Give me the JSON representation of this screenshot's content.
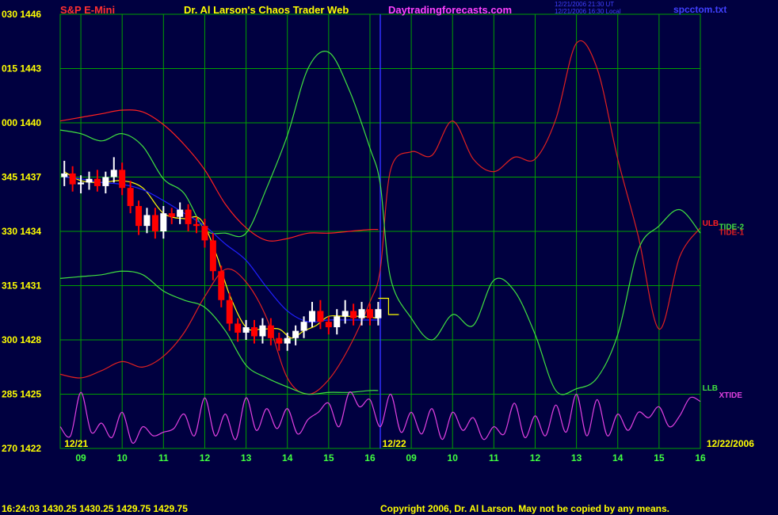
{
  "header": {
    "symbol": "S&P E-Mini",
    "title": "Dr. Al Larson's Chaos Trader Web",
    "site": "Daytradingforecasts.com",
    "stamp_line1": "12/21/2006 21:30 UT",
    "stamp_line2": "12/21/2006 16:30 Local",
    "file": "spcctom.txt"
  },
  "footer": {
    "status": "16:24:03  1430.25  1430.25  1429.75  1429.75",
    "copyright": "Copyright 2006, Dr. Al Larson. May not be copied by any means."
  },
  "colors": {
    "background": "#000040",
    "grid": "#00a000",
    "price_up": "#ffffff",
    "price_down": "#ff0000",
    "ulb": "#ff2020",
    "tide1": "#e02020",
    "tide2": "#40e040",
    "llb": "#40e040",
    "xtide": "#e040e0",
    "moving_avg_fast": "#ffff00",
    "moving_avg_slow": "#2020ff",
    "divider": "#3030ff",
    "title_color": "#ffff00",
    "site_color": "#ff40ff"
  },
  "chart_data": {
    "type": "line",
    "title": "S&P E-Mini",
    "ylabel_pairs": [
      "030 1446",
      "015 1443",
      "000 1440",
      "345 1437",
      "330 1434",
      "315 1431",
      "300 1428",
      "285 1425",
      "270 1422"
    ],
    "ylim": [
      1422,
      1446
    ],
    "y_ticks": [
      1446,
      1443,
      1440,
      1437,
      1434,
      1431,
      1428,
      1425,
      1422
    ],
    "xlim": [
      8.5,
      24.0
    ],
    "x_ticks": [
      {
        "x": 9,
        "label": "09"
      },
      {
        "x": 10,
        "label": "10"
      },
      {
        "x": 11,
        "label": "11"
      },
      {
        "x": 12,
        "label": "12"
      },
      {
        "x": 13,
        "label": "13"
      },
      {
        "x": 14,
        "label": "14"
      },
      {
        "x": 15,
        "label": "15"
      },
      {
        "x": 16,
        "label": "16"
      },
      {
        "x": 17,
        "label": "09"
      },
      {
        "x": 18,
        "label": "10"
      },
      {
        "x": 19,
        "label": "11"
      },
      {
        "x": 20,
        "label": "12"
      },
      {
        "x": 21,
        "label": "13"
      },
      {
        "x": 22,
        "label": "14"
      },
      {
        "x": 23,
        "label": "15"
      },
      {
        "x": 24,
        "label": "16"
      }
    ],
    "date_labels": [
      {
        "x": 8.6,
        "label": "12/21"
      },
      {
        "x": 16.3,
        "label": "12/22"
      },
      {
        "x": 24.15,
        "label": "12/22/2006"
      }
    ],
    "day_divider_x": 16.25,
    "grid": true,
    "series": [
      {
        "name": "ULB",
        "key": "ulb",
        "x": [
          8.5,
          9.0,
          9.5,
          10.0,
          10.5,
          11.0,
          11.5,
          12.0,
          12.5,
          13.0,
          13.5,
          14.0,
          14.5,
          15.0,
          15.5,
          16.0,
          16.2
        ],
        "y": [
          1440.1,
          1440.3,
          1440.5,
          1440.7,
          1440.6,
          1439.9,
          1438.8,
          1437.4,
          1435.5,
          1434.2,
          1433.5,
          1433.6,
          1433.9,
          1433.9,
          1434.0,
          1434.1,
          1434.1
        ]
      },
      {
        "name": "TIDE-1",
        "key": "tide1",
        "x": [
          8.5,
          9.0,
          9.5,
          10.0,
          10.5,
          11.0,
          11.5,
          12.0,
          12.5,
          13.0,
          13.5,
          14.0,
          14.5,
          15.0,
          15.5,
          16.0,
          16.25,
          16.5,
          17.0,
          17.5,
          18.0,
          18.5,
          19.0,
          19.5,
          20.0,
          20.5,
          21.0,
          21.5,
          22.0,
          22.5,
          23.0,
          23.5,
          24.0
        ],
        "y": [
          1426.1,
          1425.9,
          1426.3,
          1426.8,
          1426.5,
          1427.1,
          1428.4,
          1430.4,
          1431.9,
          1431.2,
          1429.2,
          1425.9,
          1425.0,
          1425.8,
          1427.6,
          1430.1,
          1431.9,
          1437.4,
          1438.4,
          1438.2,
          1440.1,
          1438.0,
          1437.3,
          1438.1,
          1438.0,
          1440.2,
          1444.4,
          1443.0,
          1438.0,
          1433.7,
          1428.6,
          1432.6,
          1434.2
        ]
      },
      {
        "name": "TIDE-2",
        "key": "tide2",
        "x": [
          8.5,
          9.0,
          9.5,
          10.0,
          10.5,
          11.0,
          11.5,
          12.0,
          12.5,
          13.0,
          13.5,
          14.0,
          14.5,
          15.0,
          15.5,
          16.0,
          16.25,
          16.5,
          17.0,
          17.5,
          18.0,
          18.5,
          19.0,
          19.5,
          20.0,
          20.5,
          21.0,
          21.5,
          22.0,
          22.5,
          23.0,
          23.5,
          24.0
        ],
        "y": [
          1439.6,
          1439.4,
          1439.0,
          1439.4,
          1438.7,
          1436.9,
          1436.1,
          1434.1,
          1433.9,
          1433.9,
          1436.4,
          1439.3,
          1443.0,
          1443.9,
          1441.8,
          1438.6,
          1436.6,
          1431.4,
          1429.2,
          1428.0,
          1429.4,
          1428.8,
          1431.3,
          1430.7,
          1428.3,
          1425.2,
          1425.3,
          1425.9,
          1428.3,
          1433.0,
          1434.3,
          1435.2,
          1433.9
        ]
      },
      {
        "name": "LLB",
        "key": "llb",
        "x": [
          8.5,
          9.0,
          9.5,
          10.0,
          10.5,
          11.0,
          11.5,
          12.0,
          12.5,
          13.0,
          13.5,
          14.0,
          14.5,
          15.0,
          15.5,
          16.0,
          16.2
        ],
        "y": [
          1431.4,
          1431.5,
          1431.6,
          1431.8,
          1431.6,
          1430.7,
          1430.2,
          1429.8,
          1428.5,
          1426.6,
          1425.9,
          1425.4,
          1425.0,
          1425.1,
          1425.1,
          1425.2,
          1425.2
        ]
      },
      {
        "name": "XTIDE",
        "key": "xtide",
        "x": [
          8.5,
          8.75,
          9.0,
          9.25,
          9.5,
          9.75,
          10.0,
          10.25,
          10.5,
          10.75,
          11.0,
          11.25,
          11.5,
          11.75,
          12.0,
          12.25,
          12.5,
          12.75,
          13.0,
          13.25,
          13.5,
          13.75,
          14.0,
          14.25,
          14.5,
          14.75,
          15.0,
          15.25,
          15.5,
          15.75,
          16.0,
          16.25,
          16.5,
          16.75,
          17.0,
          17.25,
          17.5,
          17.75,
          18.0,
          18.25,
          18.5,
          18.75,
          19.0,
          19.25,
          19.5,
          19.75,
          20.0,
          20.25,
          20.5,
          20.75,
          21.0,
          21.25,
          21.5,
          21.75,
          22.0,
          22.25,
          22.5,
          22.75,
          23.0,
          23.25,
          23.5,
          23.75,
          24.0
        ],
        "y": [
          1423.2,
          1422.7,
          1425.1,
          1422.9,
          1423.4,
          1422.6,
          1424.0,
          1422.3,
          1423.2,
          1422.7,
          1422.9,
          1423.1,
          1423.9,
          1422.7,
          1424.8,
          1422.7,
          1423.9,
          1422.5,
          1424.8,
          1423.0,
          1424.2,
          1423.1,
          1424.2,
          1422.8,
          1423.6,
          1424.0,
          1424.5,
          1423.2,
          1425.1,
          1424.3,
          1424.7,
          1423.2,
          1425.0,
          1422.9,
          1424.0,
          1422.8,
          1424.2,
          1422.5,
          1424.0,
          1423.0,
          1423.7,
          1422.5,
          1423.2,
          1422.8,
          1424.5,
          1422.6,
          1423.8,
          1422.7,
          1424.4,
          1422.9,
          1425.0,
          1422.7,
          1424.7,
          1422.7,
          1423.9,
          1423.0,
          1424.0,
          1423.7,
          1424.3,
          1423.2,
          1423.8,
          1424.8,
          1424.6
        ]
      },
      {
        "name": "fast average",
        "key": "moving_avg_fast",
        "x": [
          8.6,
          9.0,
          9.5,
          10.0,
          10.5,
          11.0,
          11.5,
          11.8,
          12.0,
          12.3,
          12.6,
          13.0,
          13.4,
          13.8,
          14.1,
          14.4,
          14.7,
          15.0,
          15.4,
          15.8,
          16.2
        ],
        "y": [
          1437.3,
          1436.8,
          1436.7,
          1436.8,
          1436.4,
          1435.0,
          1434.7,
          1434.8,
          1434.3,
          1432.6,
          1430.5,
          1428.7,
          1428.6,
          1428.6,
          1428.1,
          1428.5,
          1428.8,
          1429.3,
          1429.3,
          1429.3,
          1429.2
        ]
      },
      {
        "name": "slow average",
        "key": "moving_avg_slow",
        "x": [
          8.6,
          9.0,
          9.5,
          10.0,
          10.5,
          11.0,
          11.5,
          12.0,
          12.5,
          13.0,
          13.5,
          14.0,
          14.5,
          15.0,
          15.5,
          16.2
        ],
        "y": [
          1437.0,
          1436.9,
          1436.7,
          1436.6,
          1436.3,
          1435.7,
          1435.0,
          1434.3,
          1433.3,
          1432.4,
          1430.9,
          1429.6,
          1429.0,
          1429.1,
          1429.1,
          1429.1
        ]
      },
      {
        "name": "projection",
        "key": "moving_avg_fast",
        "x": [
          16.2,
          16.45,
          16.45,
          16.7
        ],
        "y": [
          1430.3,
          1430.3,
          1429.4,
          1429.4
        ]
      }
    ],
    "price_bars": {
      "x": [
        8.6,
        8.8,
        9.0,
        9.2,
        9.4,
        9.6,
        9.8,
        10.0,
        10.2,
        10.4,
        10.6,
        10.8,
        11.0,
        11.2,
        11.4,
        11.6,
        11.8,
        12.0,
        12.2,
        12.4,
        12.6,
        12.8,
        13.0,
        13.2,
        13.4,
        13.6,
        13.8,
        14.0,
        14.2,
        14.4,
        14.6,
        14.8,
        15.0,
        15.2,
        15.4,
        15.6,
        15.8,
        16.0,
        16.2
      ],
      "open": [
        1437.0,
        1437.2,
        1436.6,
        1436.7,
        1436.9,
        1436.5,
        1437.0,
        1437.4,
        1436.4,
        1435.4,
        1434.3,
        1434.9,
        1434.0,
        1435.0,
        1434.8,
        1435.2,
        1434.4,
        1434.3,
        1433.5,
        1431.8,
        1430.2,
        1428.9,
        1428.4,
        1428.7,
        1428.2,
        1428.8,
        1428.1,
        1427.8,
        1428.1,
        1428.5,
        1429.0,
        1429.6,
        1429.0,
        1428.7,
        1429.3,
        1429.6,
        1429.2,
        1429.7,
        1429.2
      ],
      "close": [
        1437.2,
        1436.6,
        1436.7,
        1436.9,
        1436.5,
        1437.0,
        1437.4,
        1436.4,
        1435.4,
        1434.3,
        1434.9,
        1434.0,
        1435.0,
        1434.8,
        1435.2,
        1434.4,
        1434.3,
        1433.5,
        1431.8,
        1430.2,
        1428.9,
        1428.4,
        1428.7,
        1428.2,
        1428.8,
        1428.1,
        1427.8,
        1428.1,
        1428.5,
        1429.0,
        1429.6,
        1429.0,
        1428.7,
        1429.3,
        1429.6,
        1429.2,
        1429.7,
        1429.2,
        1429.7
      ],
      "high": [
        1437.9,
        1437.6,
        1437.1,
        1437.3,
        1437.4,
        1437.3,
        1438.1,
        1437.8,
        1436.8,
        1435.7,
        1435.3,
        1435.3,
        1435.4,
        1435.3,
        1435.6,
        1435.5,
        1434.8,
        1434.7,
        1433.9,
        1432.1,
        1430.6,
        1429.2,
        1429.1,
        1429.1,
        1429.2,
        1429.2,
        1428.4,
        1428.4,
        1428.8,
        1429.3,
        1430.1,
        1430.2,
        1429.3,
        1429.7,
        1430.2,
        1430.0,
        1430.1,
        1430.0,
        1430.1
      ],
      "low": [
        1436.5,
        1436.2,
        1436.1,
        1436.3,
        1436.2,
        1436.1,
        1436.7,
        1436.0,
        1435.0,
        1433.8,
        1433.9,
        1433.6,
        1433.6,
        1434.4,
        1434.4,
        1434.0,
        1433.9,
        1433.1,
        1431.3,
        1429.8,
        1428.5,
        1427.9,
        1428.0,
        1427.8,
        1427.8,
        1427.7,
        1427.4,
        1427.4,
        1427.7,
        1428.1,
        1428.7,
        1428.6,
        1428.3,
        1428.3,
        1428.9,
        1428.8,
        1428.8,
        1428.8,
        1428.8
      ]
    },
    "end_labels": [
      {
        "text": "ULB",
        "key": "ulb",
        "x": 24.05,
        "y": 1434.3
      },
      {
        "text": "TIDE-2",
        "key": "tide2",
        "x": 24.45,
        "y": 1434.1
      },
      {
        "text": "TIDE-1",
        "key": "tide1",
        "x": 24.45,
        "y": 1433.8
      },
      {
        "text": "LLB",
        "key": "llb",
        "x": 24.05,
        "y": 1425.2
      },
      {
        "text": "XTIDE",
        "key": "xtide",
        "x": 24.45,
        "y": 1424.8
      }
    ]
  }
}
